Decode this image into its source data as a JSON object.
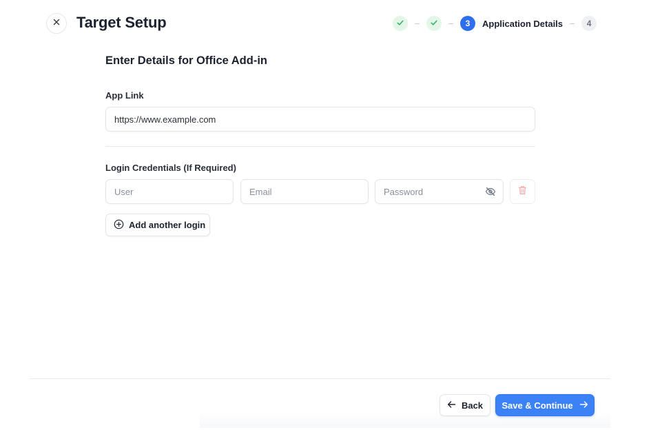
{
  "header": {
    "title": "Target Setup",
    "close_icon": "close-icon"
  },
  "stepper": {
    "steps": [
      {
        "status": "complete",
        "icon": "check-icon"
      },
      {
        "status": "complete",
        "icon": "check-icon"
      },
      {
        "number": "3",
        "label": "Application Details",
        "status": "current"
      },
      {
        "number": "4",
        "status": "pending"
      }
    ]
  },
  "form": {
    "heading": "Enter Details for Office Add-in",
    "app_link": {
      "label": "App Link",
      "value": "https://www.example.com"
    },
    "credentials": {
      "label": "Login Credentials (If Required)",
      "user_placeholder": "User",
      "email_placeholder": "Email",
      "password_placeholder": "Password",
      "password_toggle_icon": "eye-off-icon",
      "delete_icon": "trash-icon"
    },
    "add_login_label": "Add another login",
    "add_login_icon": "plus-circle-icon"
  },
  "footer": {
    "back_label": "Back",
    "save_label": "Save & Continue"
  },
  "colors": {
    "accent": "#3b82f6",
    "step_current": "#2f6fed",
    "step_done_bg": "#e3f6e8",
    "check_green": "#34b865",
    "delete_red": "#f2a6a6"
  }
}
